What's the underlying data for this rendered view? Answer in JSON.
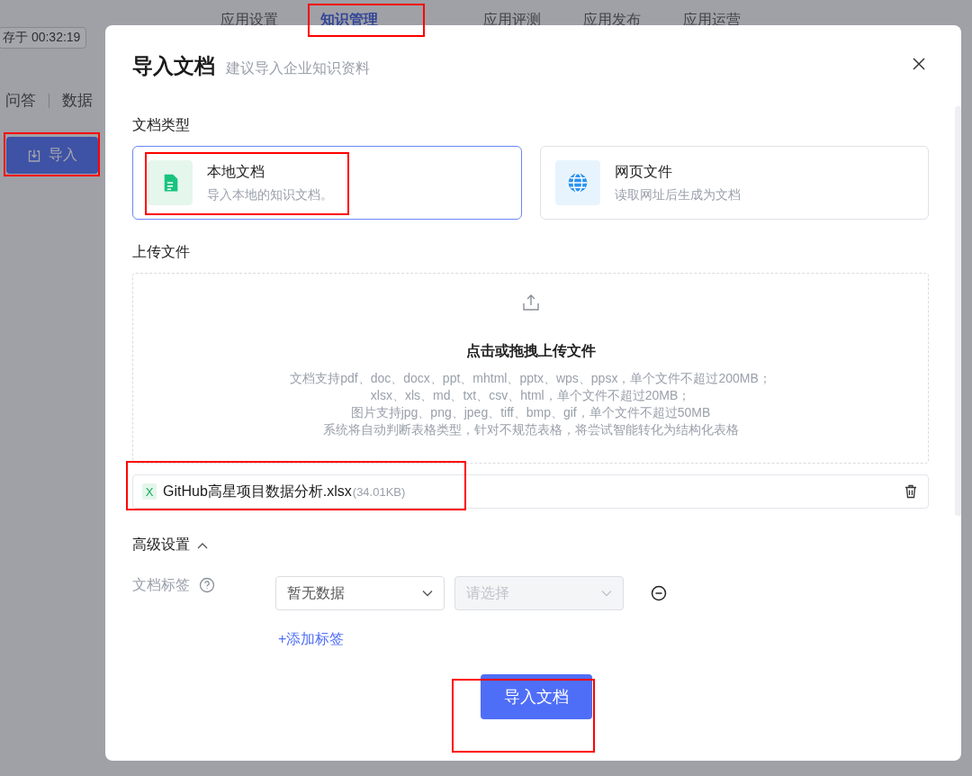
{
  "background": {
    "tabs": [
      {
        "label": "应用设置",
        "selected": false
      },
      {
        "label": "知识管理",
        "selected": true
      },
      {
        "label": "应用评测",
        "selected": false
      },
      {
        "label": "应用发布",
        "selected": false
      },
      {
        "label": "应用运营",
        "selected": false
      }
    ],
    "save_status": "存于 00:32:19",
    "subtabs": [
      "问答",
      "数据"
    ],
    "import_button": "导入"
  },
  "dialog": {
    "title": "导入文档",
    "subtitle": "建议导入企业知识资料",
    "doc_type_label": "文档类型",
    "doc_types": [
      {
        "kind": "local",
        "title": "本地文档",
        "description": "导入本地的知识文档。",
        "selected": true
      },
      {
        "kind": "web",
        "title": "网页文件",
        "description": "读取网址后生成为文档",
        "selected": false
      }
    ],
    "upload_label": "上传文件",
    "upload": {
      "prompt": "点击或拖拽上传文件",
      "hints": [
        "文档支持pdf、doc、docx、ppt、mhtml、pptx、wps、ppsx，单个文件不超过200MB；",
        "xlsx、xls、md、txt、csv、html，单个文件不超过20MB；",
        "图片支持jpg、png、jpeg、tiff、bmp、gif，单个文件不超过50MB",
        "系统将自动判断表格类型，针对不规范表格，将尝试智能转化为结构化表格"
      ]
    },
    "files": [
      {
        "badge": "X",
        "name": "GitHub高星项目数据分析.xlsx",
        "size": "(34.01KB)"
      }
    ],
    "advanced": {
      "label": "高级设置",
      "expanded": true
    },
    "tag_field": {
      "label": "文档标签",
      "selects": [
        {
          "value": "暂无数据",
          "disabled": false
        },
        {
          "placeholder": "请选择",
          "disabled": true
        }
      ],
      "add_link": "+添加标签"
    },
    "submit": "导入文档"
  }
}
